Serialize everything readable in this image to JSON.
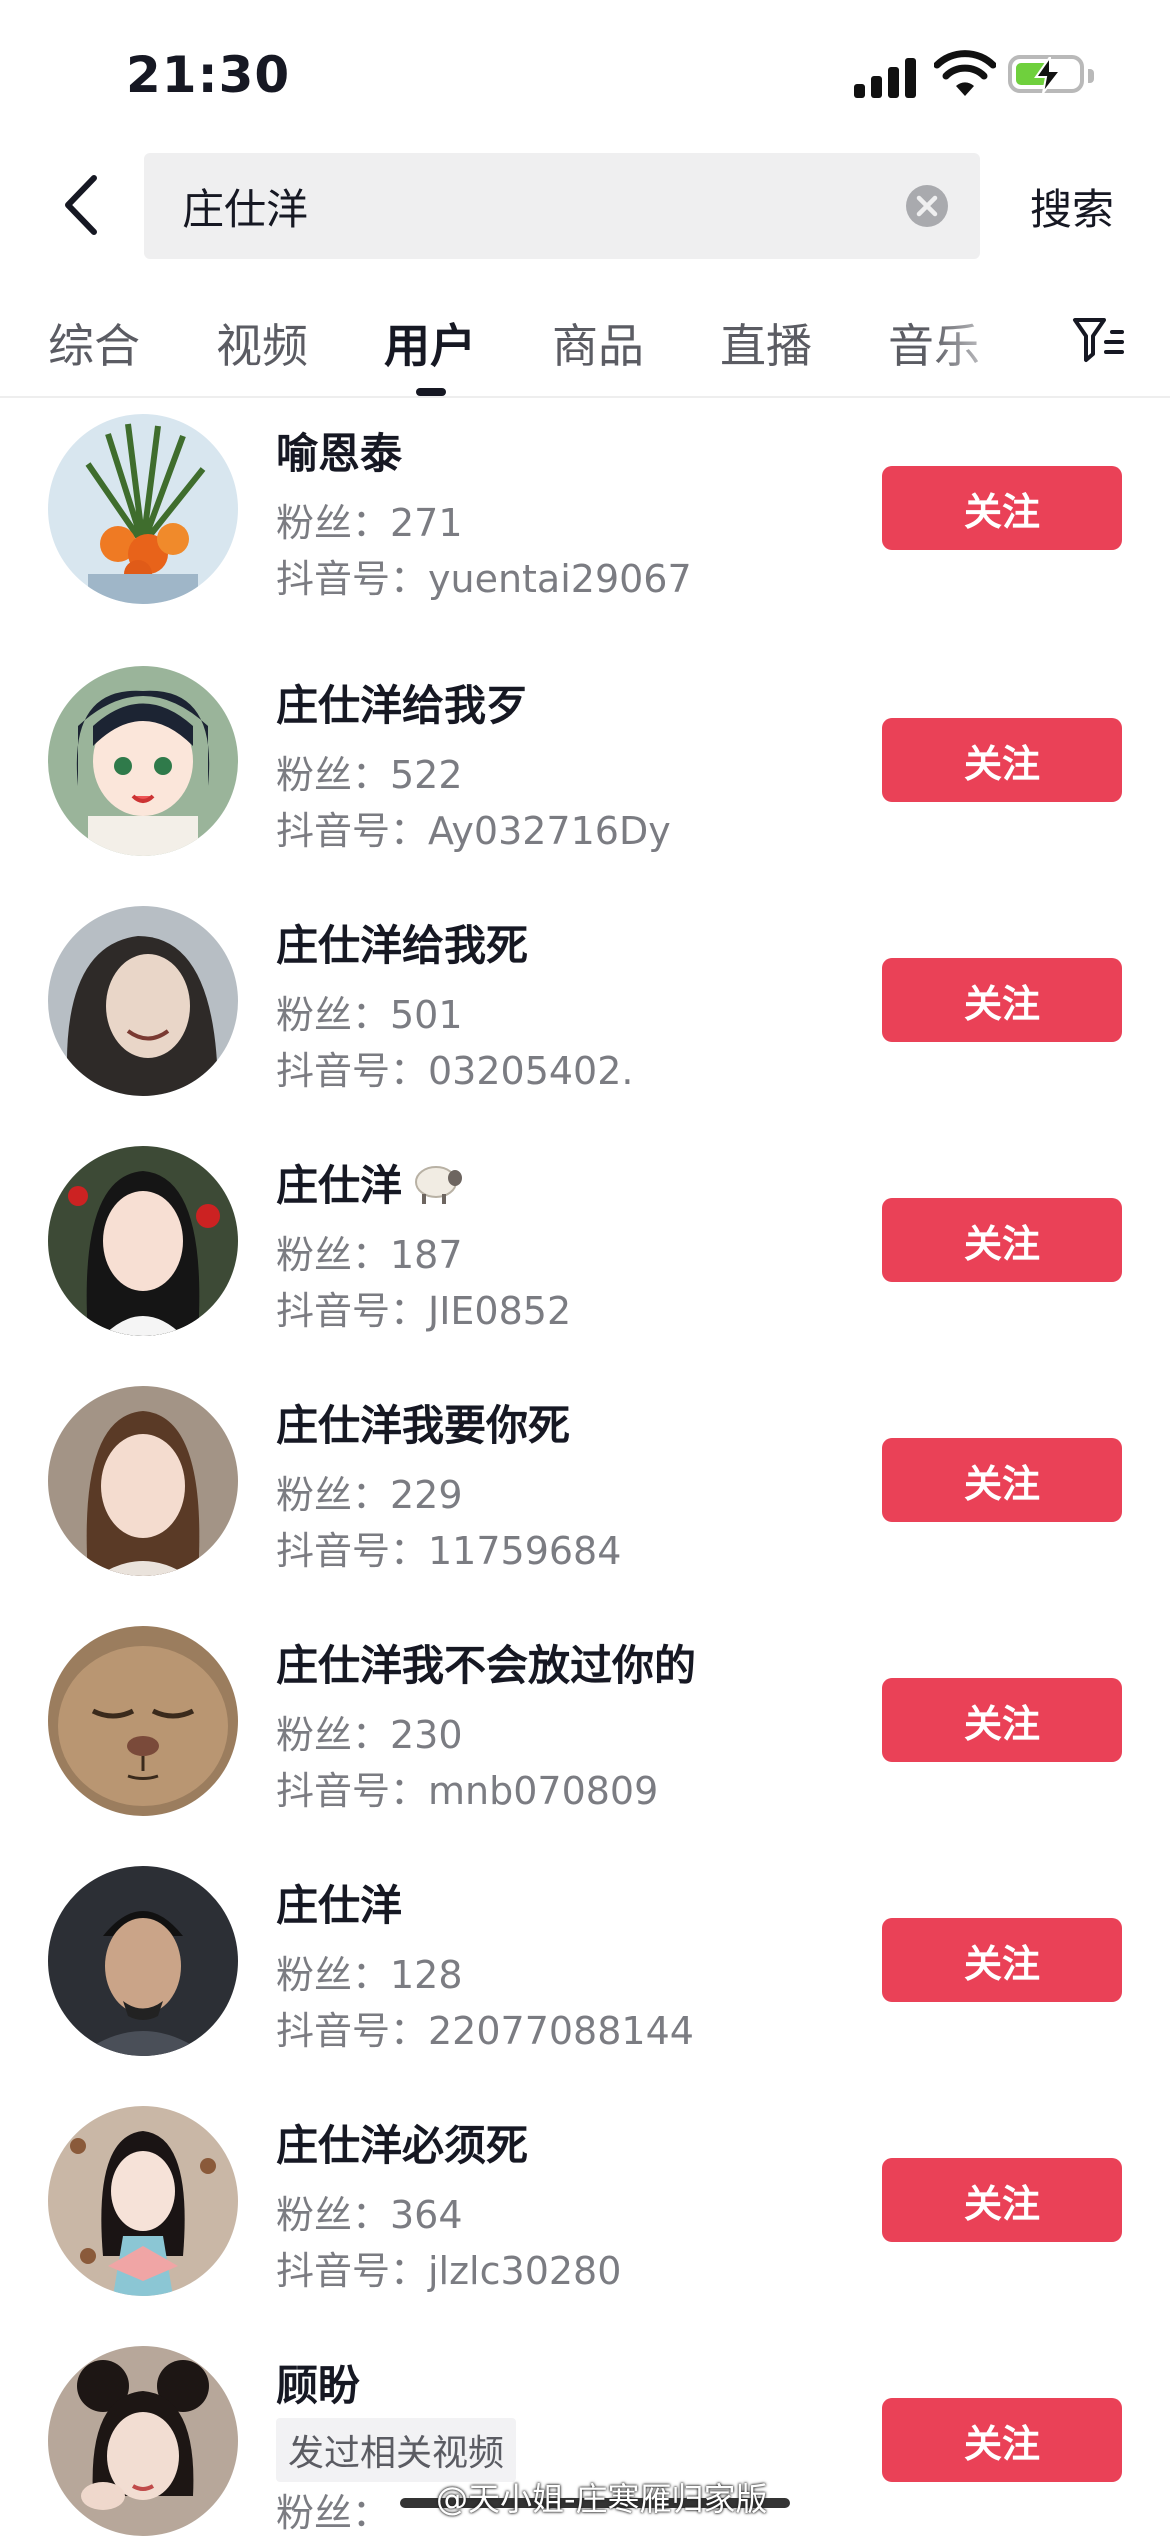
{
  "status_bar": {
    "time": "21:30"
  },
  "search": {
    "query": "庄仕洋",
    "button_label": "搜索"
  },
  "tabs": [
    {
      "label": "综合"
    },
    {
      "label": "视频"
    },
    {
      "label": "用户"
    },
    {
      "label": "商品"
    },
    {
      "label": "直播"
    },
    {
      "label": "音乐"
    }
  ],
  "active_tab": "用户",
  "users": [
    {
      "name": "喻恩泰",
      "fans": "粉丝：271",
      "douyin_id": "抖音号：yuentai29067",
      "follow_label": "关注"
    },
    {
      "name": "庄仕洋给我歹",
      "fans": "粉丝：522",
      "douyin_id": "抖音号：Ay032716Dy",
      "follow_label": "关注"
    },
    {
      "name": "庄仕洋给我死",
      "fans": "粉丝：501",
      "douyin_id": "抖音号：03205402.",
      "follow_label": "关注"
    },
    {
      "name": "庄仕洋",
      "fans": "粉丝：187",
      "douyin_id": "抖音号：JIE0852",
      "follow_label": "关注",
      "icon": "sheep-icon"
    },
    {
      "name": "庄仕洋我要你死",
      "fans": "粉丝：229",
      "douyin_id": "抖音号：11759684",
      "follow_label": "关注"
    },
    {
      "name": "庄仕洋我不会放过你的",
      "fans": "粉丝：230",
      "douyin_id": "抖音号：mnb070809",
      "follow_label": "关注"
    },
    {
      "name": "庄仕洋",
      "fans": "粉丝：128",
      "douyin_id": "抖音号：22077088144",
      "follow_label": "关注"
    },
    {
      "name": "庄仕洋必须死",
      "fans": "粉丝：364",
      "douyin_id": "抖音号：jlzlc30280",
      "follow_label": "关注"
    },
    {
      "name": "顾盼",
      "badge": "发过相关视频",
      "fans": "粉丝：",
      "follow_label": "关注"
    }
  ],
  "watermark": "@天小姐-庄寒雁归家版",
  "colors": {
    "follow_button": "#ea4157",
    "text_primary": "#161823",
    "text_secondary": "#7b7c82",
    "search_bg": "#efeff0"
  }
}
